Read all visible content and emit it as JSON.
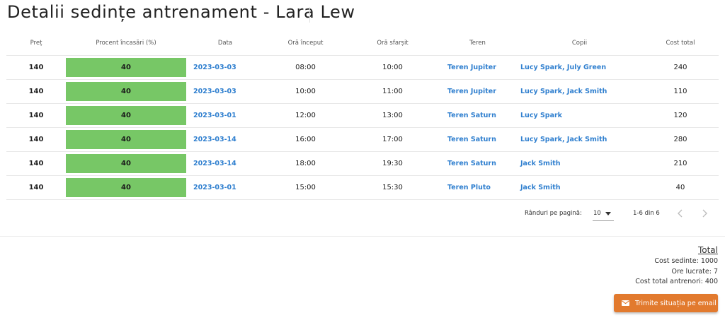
{
  "page": {
    "title": "Detalii sedințe antrenament - Lara Lew"
  },
  "table": {
    "headers": [
      "Preț",
      "Procent încasări (%)",
      "Data",
      "Oră început",
      "Oră sfarșit",
      "Teren",
      "Copii",
      "Cost total"
    ],
    "rows": [
      {
        "pret": "140",
        "procent": "40",
        "data": "2023-03-03",
        "start": "08:00",
        "end": "10:00",
        "teren": "Teren Jupiter",
        "copii": "Lucy Spark, July Green",
        "cost": "240"
      },
      {
        "pret": "140",
        "procent": "40",
        "data": "2023-03-03",
        "start": "10:00",
        "end": "11:00",
        "teren": "Teren Jupiter",
        "copii": "Lucy Spark, Jack Smith",
        "cost": "110"
      },
      {
        "pret": "140",
        "procent": "40",
        "data": "2023-03-01",
        "start": "12:00",
        "end": "13:00",
        "teren": "Teren Saturn",
        "copii": "Lucy Spark",
        "cost": "120"
      },
      {
        "pret": "140",
        "procent": "40",
        "data": "2023-03-14",
        "start": "16:00",
        "end": "17:00",
        "teren": "Teren Saturn",
        "copii": "Lucy Spark, Jack Smith",
        "cost": "280"
      },
      {
        "pret": "140",
        "procent": "40",
        "data": "2023-03-14",
        "start": "18:00",
        "end": "19:30",
        "teren": "Teren Saturn",
        "copii": "Jack Smith",
        "cost": "210"
      },
      {
        "pret": "140",
        "procent": "40",
        "data": "2023-03-01",
        "start": "15:00",
        "end": "15:30",
        "teren": "Teren Pluto",
        "copii": "Jack Smith",
        "cost": "40"
      }
    ]
  },
  "pagination": {
    "rows_label": "Rânduri pe pagină:",
    "rows_value": "10",
    "range": "1-6 din 6",
    "prev_icon": "chevron-left-icon",
    "next_icon": "chevron-right-icon"
  },
  "summary": {
    "title": "Total",
    "cost_sedinte": "Cost sedinte: 1000",
    "ore_lucrate": "Ore lucrate: 7",
    "cost_antrenori": "Cost total antrenori: 400"
  },
  "actions": {
    "email_button": "Trimite situația pe email",
    "email_icon": "mail-icon"
  },
  "colors": {
    "percent_bar": "#77c766",
    "link": "#2f7fcf",
    "email_button": "#e27a2e"
  }
}
